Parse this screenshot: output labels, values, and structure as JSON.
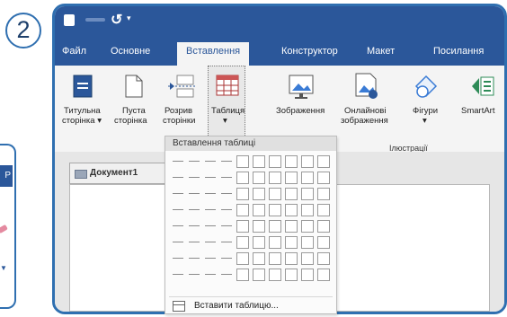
{
  "step_number": "2",
  "left_fragment": {
    "bar_text": "P"
  },
  "quick_access": {
    "redo_glyph": "↺",
    "customize_glyph": "▾"
  },
  "tabs": [
    "Файл",
    "Основне",
    "Вставлення",
    "Конструктор",
    "Макет",
    "Посилання"
  ],
  "active_tab": "Вставлення",
  "ribbon": {
    "buttons": [
      {
        "id": "title-page",
        "label1": "Титульна",
        "label2": "сторінка ▾",
        "icon": "title-page-icon"
      },
      {
        "id": "blank-page",
        "label1": "Пуста",
        "label2": "сторінка",
        "icon": "blank-page-icon"
      },
      {
        "id": "page-break",
        "label1": "Розрив",
        "label2": "сторінки",
        "icon": "page-break-icon"
      },
      {
        "id": "table",
        "label1": "Таблиця",
        "label2": "▾",
        "icon": "table-icon"
      },
      {
        "id": "pictures",
        "label1": "Зображення",
        "label2": "",
        "icon": "pictures-icon"
      },
      {
        "id": "online-pictures",
        "label1": "Онлайнові",
        "label2": "зображення",
        "icon": "online-pictures-icon"
      },
      {
        "id": "shapes",
        "label1": "Фігури",
        "label2": "▾",
        "icon": "shapes-icon"
      },
      {
        "id": "smartart",
        "label1": "SmartArt",
        "label2": "",
        "icon": "smartart-icon"
      }
    ],
    "group_label": "Ілюстрації"
  },
  "table_dropdown": {
    "title": "Вставлення таблиці",
    "insert_label": "Вставити таблицю...",
    "grid_cols": 10,
    "grid_rows": 8
  },
  "document": {
    "tab_label": "Документ1"
  },
  "colors": {
    "accent": "#2b579a",
    "frame": "#2f6fb0",
    "ribbon_bg": "#f4f4f4"
  }
}
